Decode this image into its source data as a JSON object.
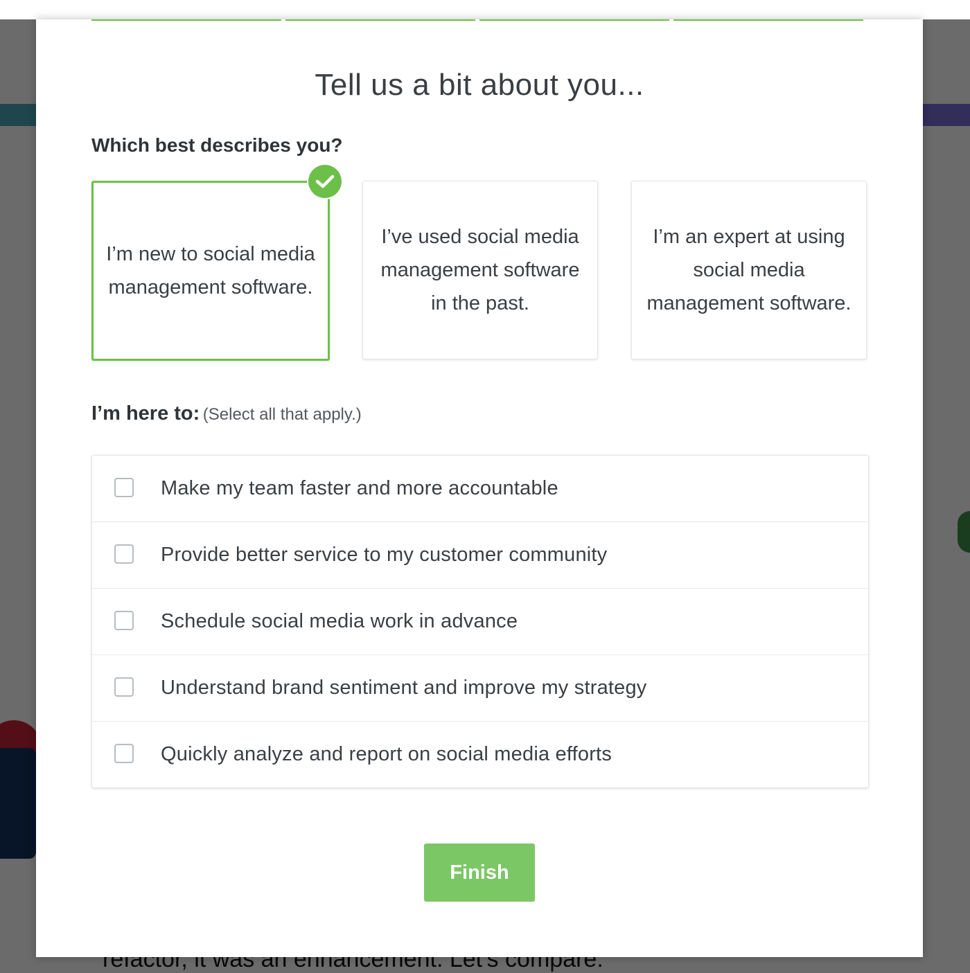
{
  "background": {
    "snippet_text": "refactor, it was an enhancement. Let's compare:"
  },
  "modal": {
    "title": "Tell us a bit about you...",
    "describe_label": "Which best describes you?",
    "cards": [
      {
        "label": "I’m new to social media management software.",
        "selected": true
      },
      {
        "label": "I’ve used social media management software in the past.",
        "selected": false
      },
      {
        "label": "I’m an expert at using social media management software.",
        "selected": false
      }
    ],
    "here_label": "I’m here to:",
    "here_note": "(Select all that apply.)",
    "options": [
      {
        "label": "Make my team faster and more accountable",
        "checked": false
      },
      {
        "label": "Provide better service to my customer community",
        "checked": false
      },
      {
        "label": "Schedule social media work in advance",
        "checked": false
      },
      {
        "label": "Understand brand sentiment and improve my strategy",
        "checked": false
      },
      {
        "label": "Quickly analyze and report on social media efforts",
        "checked": false
      }
    ],
    "finish_label": "Finish"
  },
  "colors": {
    "accent_green": "#6cc04a",
    "button_green": "#7cc765",
    "text_dark": "#3a3f44"
  },
  "icons": {
    "selected_badge": "checkmark-icon"
  }
}
